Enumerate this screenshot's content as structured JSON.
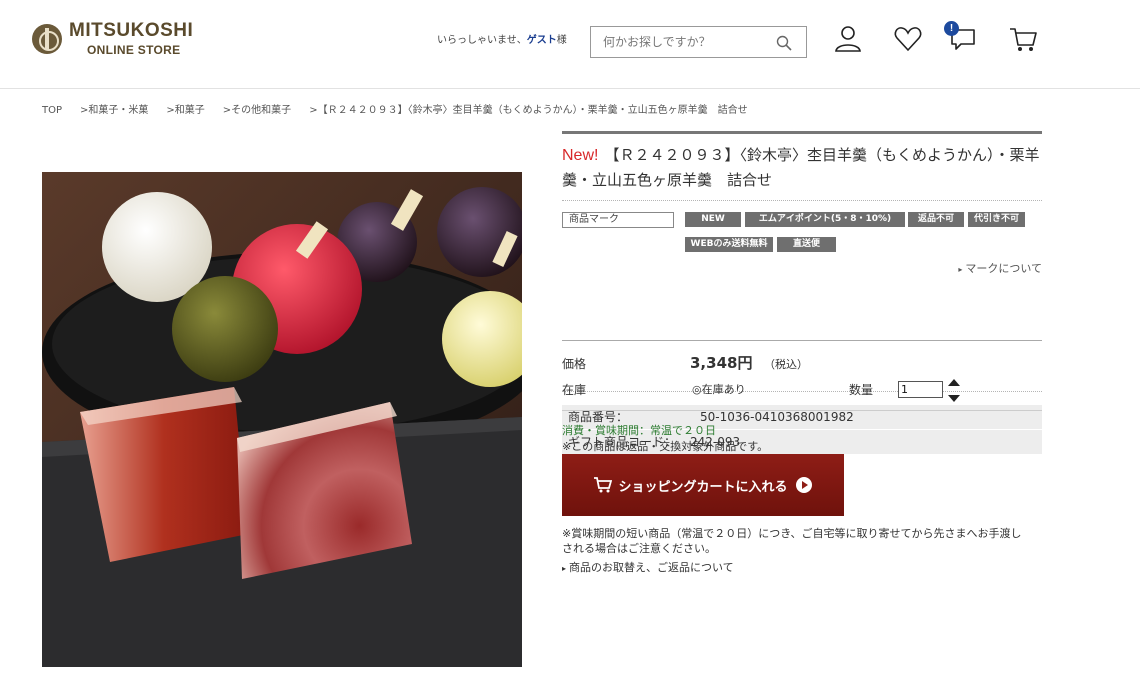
{
  "header": {
    "logo_main": "MITSUKOSHI",
    "logo_sub": "ONLINE STORE",
    "greeting_prefix": "いらっしゃいませ、",
    "greeting_user": "ゲスト",
    "greeting_suffix": "様",
    "search_placeholder": "何かお探しですか？",
    "notification_badge": "!"
  },
  "breadcrumb": [
    "TOP",
    ">和菓子・米菓",
    ">和菓子",
    ">その他和菓子",
    ">【Ｒ２４２０９３】〈鈴木亭〉杢目羊羹（もくめようかん）・栗羊羹・立山五色ヶ原羊羹　詰合せ"
  ],
  "product": {
    "new_label": "New!",
    "title": "【Ｒ２４２０９３】〈鈴木亭〉杢目羊羹（もくめようかん）・栗羊羹・立山五色ヶ原羊羹　詰合せ",
    "mark_label": "商品マーク",
    "tags": [
      "NEW",
      "エムアイポイント(5・8・10%)",
      "返品不可",
      "代引き不可",
      "WEBのみ送料無料",
      "直送便"
    ],
    "mark_link": "マークについて",
    "product_number_label": "商品番号：",
    "product_number": "50-1036-0410368001982",
    "gift_code_label": "ギフト商品コード：",
    "gift_code": "242-093",
    "price_label": "価格",
    "price": "3,348円",
    "tax_note": "（税込）",
    "stock_label": "在庫",
    "stock_value": "◎在庫あり",
    "qty_label": "数量",
    "qty_value": "1",
    "shelf_life": "消費・賞味期間：常温で２０日",
    "return_note": "※この商品は返品・交換対象外商品です。",
    "cart_button": "ショッピングカートに入れる",
    "delivery_note": "※賞味期間の短い商品（常温で２０日）につき、ご自宅等に取り寄せてから先さまへお手渡しされる場合はご注意ください。",
    "return_link": "商品のお取替え、ご返品について"
  },
  "colors": {
    "accent_red": "#d8282a",
    "cart_button": "#7d150f",
    "shelf_life_green": "#2e7d32",
    "tag_gray": "#6f6f6f"
  }
}
